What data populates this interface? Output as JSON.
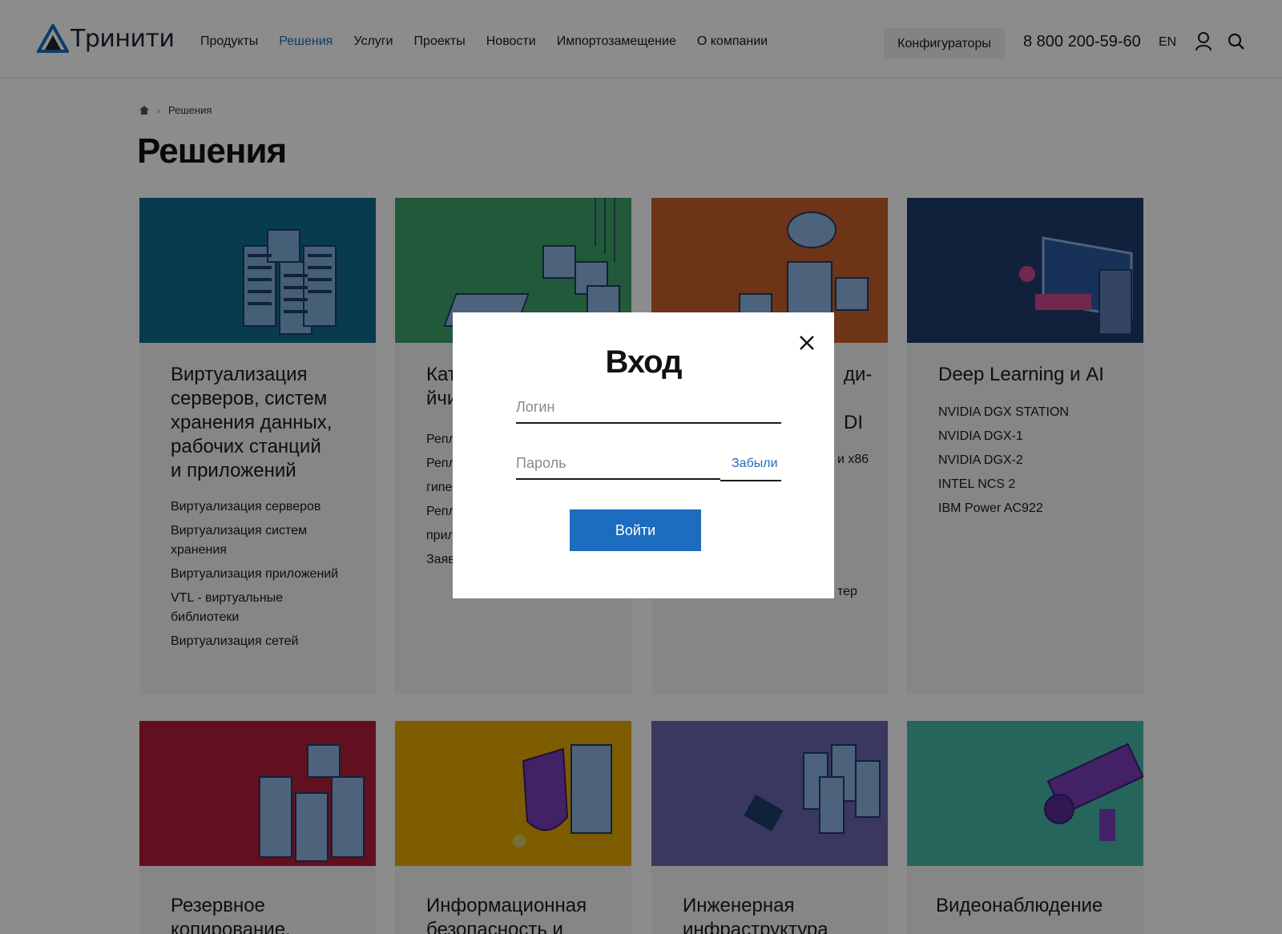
{
  "header": {
    "logo_text": "Тринити",
    "nav": [
      {
        "label": "Продукты"
      },
      {
        "label": "Решения",
        "active": true
      },
      {
        "label": "Услуги"
      },
      {
        "label": "Проекты"
      },
      {
        "label": "Новости"
      },
      {
        "label": "Импортозамещение"
      },
      {
        "label": "О компании"
      }
    ],
    "configurators_label": "Конфигураторы",
    "phone": "8 800 200-59-60",
    "lang": "EN",
    "icons": [
      "user-icon",
      "search-icon"
    ]
  },
  "breadcrumb": {
    "home_icon": "home-icon",
    "current": "Решения"
  },
  "page_title": "Решения",
  "cards": [
    {
      "title_lines": [
        "Виртуализация",
        "серверов, систем",
        "хранения данных,",
        "рабочих станций",
        "и приложений"
      ],
      "links": [
        "Виртуализация серверов",
        "Виртуализация систем хранения",
        "Виртуализация приложений",
        "VTL - виртуальные библиотеки",
        "Виртуализация сетей"
      ],
      "color": "#0f6c8e"
    },
    {
      "title_lines": [
        "Кат",
        "йчи"
      ],
      "links": [
        "Репл",
        "Репл",
        "гипе",
        "Репл",
        "прил",
        "Заяв"
      ],
      "color": "#3fa36b"
    },
    {
      "title_lines": [
        "ди-",
        "DI"
      ],
      "links": [
        "и x86",
        "тер"
      ],
      "color": "#c8602a"
    },
    {
      "title_lines": [
        "Deep Learning и AI"
      ],
      "links": [
        "NVIDIA DGX STATION",
        "NVIDIA DGX-1",
        "NVIDIA DGX-2",
        "INTEL NCS 2",
        "IBM Power AC922"
      ],
      "color": "#1f3d6e"
    },
    {
      "title_lines": [
        "Резервное",
        "копирование,"
      ],
      "links": [],
      "color": "#b21d3a"
    },
    {
      "title_lines": [
        "Информационная",
        "безопасность и"
      ],
      "links": [],
      "color": "#e5a800"
    },
    {
      "title_lines": [
        "Инженерная",
        "инфраструктура"
      ],
      "links": [],
      "color": "#6b64b0"
    },
    {
      "title_lines": [
        "Видеонаблюдение"
      ],
      "links": [],
      "color": "#46b9a8"
    }
  ],
  "modal": {
    "title": "Вход",
    "login_placeholder": "Логин",
    "password_placeholder": "Пароль",
    "forgot_label": "Забыли",
    "submit_label": "Войти",
    "close_icon": "close-icon"
  },
  "colors": {
    "accent": "#1c6cc0",
    "overlay": "rgba(0,0,0,0.45)"
  }
}
